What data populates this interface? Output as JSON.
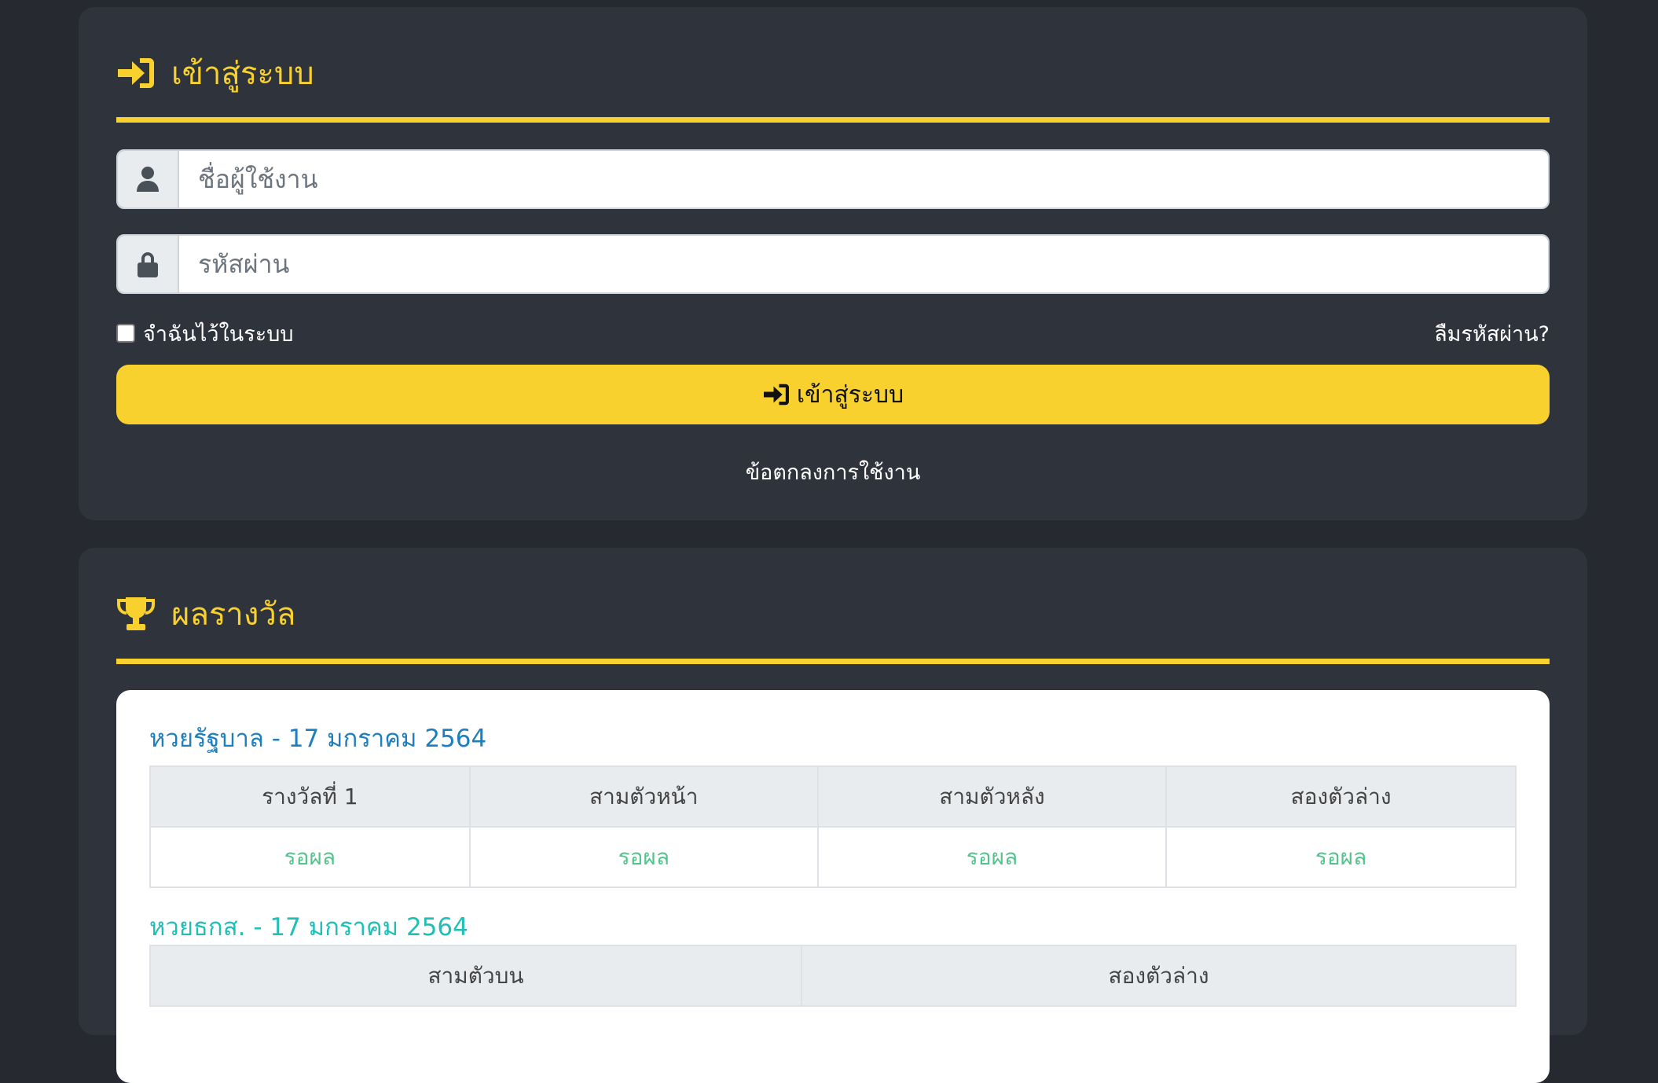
{
  "login": {
    "title": "เข้าสู่ระบบ",
    "username_placeholder": "ชื่อผู้ใช้งาน",
    "password_placeholder": "รหัสผ่าน",
    "remember_label": "จำฉันไว้ในระบบ",
    "forgot_label": "ลืมรหัสผ่าน?",
    "submit_label": "เข้าสู่ระบบ",
    "terms_label": "ข้อตกลงการใช้งาน",
    "accent_color": "#f8d12e"
  },
  "results": {
    "title": "ผลรางวัล",
    "government": {
      "title": "หวยรัฐบาล - 17 มกราคม 2564",
      "headers": [
        "รางวัลที่ 1",
        "สามตัวหน้า",
        "สามตัวหลัง",
        "สองตัวล่าง"
      ],
      "values": [
        "รอผล",
        "รอผล",
        "รอผล",
        "รอผล"
      ]
    },
    "baac": {
      "title": "หวยธกส. - 17 มกราคม 2564",
      "headers": [
        "สามตัวบน",
        "สองตัวล่าง"
      ]
    }
  }
}
